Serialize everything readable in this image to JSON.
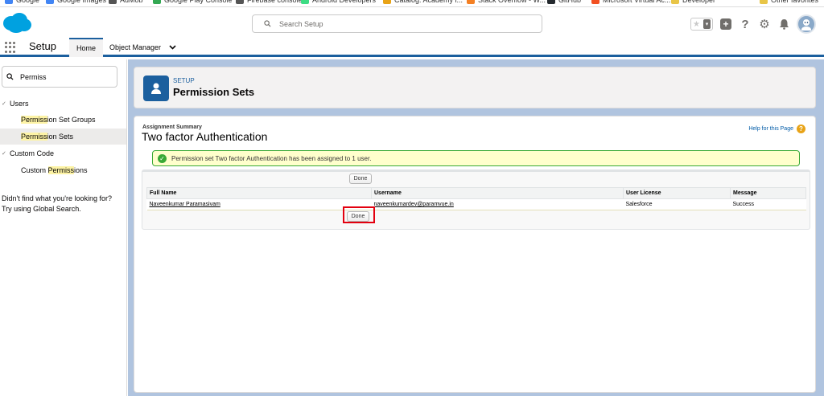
{
  "bookmarks": [
    {
      "label": "Google",
      "color": "#4285f4"
    },
    {
      "label": "Google Images",
      "color": "#4285f4"
    },
    {
      "label": "AdMob",
      "color": "#555555"
    },
    {
      "label": "Google Play Console",
      "color": "#34a853"
    },
    {
      "label": "Firebase console",
      "color": "#555555"
    },
    {
      "label": "Android Developers",
      "color": "#3ddc84"
    },
    {
      "label": "Catalog: Academy i...",
      "color": "#e8a317"
    },
    {
      "label": "Stack Overflow - W...",
      "color": "#f48024"
    },
    {
      "label": "GitHub",
      "color": "#24292e"
    },
    {
      "label": "Microsoft Virtual Ac...",
      "color": "#f25022"
    },
    {
      "label": "Developer",
      "color": "#e8c547"
    },
    {
      "label": "Other favorites",
      "color": "#e8c547"
    }
  ],
  "header": {
    "search_placeholder": "Search Setup",
    "icons": [
      "star-icon",
      "add-icon",
      "help-icon",
      "gear-icon",
      "bell-icon",
      "avatar"
    ]
  },
  "nav": {
    "app_name": "Setup",
    "tabs": [
      {
        "label": "Home",
        "active": true
      },
      {
        "label": "Object Manager",
        "dropdown": true
      }
    ]
  },
  "sidebar": {
    "quick_find_value": "Permiss",
    "groups": [
      {
        "label": "Users",
        "items": [
          {
            "pre": "",
            "hl": "Permiss",
            "post": "ion Set Groups"
          },
          {
            "pre": "",
            "hl": "Permiss",
            "post": "ion Sets",
            "selected": true
          }
        ]
      },
      {
        "label": "Custom Code",
        "items": [
          {
            "pre": "Custom ",
            "hl": "Permiss",
            "post": "ions"
          }
        ]
      }
    ],
    "not_found_line1": "Didn't find what you're looking for?",
    "not_found_line2": "Try using Global Search."
  },
  "page_header": {
    "eyebrow": "SETUP",
    "title": "Permission Sets"
  },
  "content": {
    "summary_label": "Assignment Summary",
    "title": "Two factor Authentication",
    "help_link": "Help for this Page",
    "message": "Permission set Two factor Authentication has been assigned to 1 user.",
    "done_label": "Done",
    "columns": [
      "Full Name",
      "Username",
      "User License",
      "Message"
    ],
    "rows": [
      [
        "Naveenkumar Paramasivam",
        "naveenkumardev@paramvue.in",
        "Salesforce",
        "Success"
      ]
    ]
  },
  "colors": {
    "brand": "#1b5f9e",
    "success": "#39a935",
    "highlight_box": "#e3000f"
  }
}
